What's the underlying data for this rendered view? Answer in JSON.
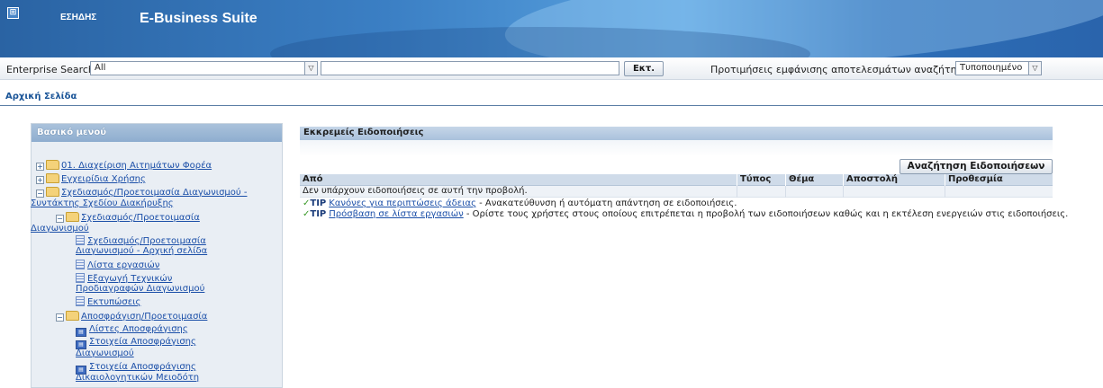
{
  "banner": {
    "brand": "ΕΣΗΔΗΣ",
    "app_title": "E-Business Suite",
    "logo_icon": "⊞"
  },
  "search": {
    "label": "Enterprise Search",
    "scope_value": "All",
    "query_value": "",
    "go_label": "Εκτ.",
    "pref_label": "Προτιμήσεις εμφάνισης αποτελεσμάτων αναζήτησης",
    "pref_value": "Τυποποιημένο"
  },
  "breadcrumb": "Αρχική Σελίδα",
  "menu": {
    "title": "Βασικό μενού",
    "items": [
      {
        "label": "01. Διαχείριση Αιτημάτων Φορέα"
      },
      {
        "label": "Εγχειρίδια Χρήσης"
      },
      {
        "label": "Σχεδιασμός/Προετοιμασία Διαγωνισμού -",
        "label2": "Συντάκτης Σχεδίου Διακήρυξης"
      },
      {
        "label": "Σχεδιασμός/Προετοιμασία",
        "label2": "Διαγωνισμού"
      },
      {
        "label": "Σχεδιασμός/Προετοιμασία",
        "label2": "Διαγωνισμού - Αρχική σελίδα"
      },
      {
        "label": "Λίστα εργασιών"
      },
      {
        "label": "Εξαγωγή Τεχνικών",
        "label2": "Προδιαγραφών Διαγωνισμού"
      },
      {
        "label": "Εκτυπώσεις"
      },
      {
        "label": "Αποσφράγιση/Προετοιμασία"
      },
      {
        "label": "Λίστες Αποσφράγισης"
      },
      {
        "label": "Στοιχεία Αποσφράγισης",
        "label2": "Διαγωνισμού"
      },
      {
        "label": "Στοιχεία Αποσφράγισης",
        "label2": "Δικαιολογητικών Μειοδότη"
      }
    ]
  },
  "notifications": {
    "title": "Εκκρεμείς Ειδοποιήσεις",
    "search_button": "Αναζήτηση Ειδοποιήσεων",
    "columns": [
      "Από",
      "Τύπος",
      "Θέμα",
      "Αποστολή",
      "Προθεσμία"
    ],
    "empty_message": "Δεν υπάρχουν ειδοποιήσεις σε αυτή την προβολή.",
    "tips": [
      {
        "label": "TIP",
        "link": "Κανόνες για περιπτώσεις άδειας",
        "text": " - Ανακατεύθυνση ή αυτόματη απάντηση σε ειδοποιήσεις."
      },
      {
        "label": "TIP",
        "link": "Πρόσβαση σε λίστα εργασιών",
        "text": " - Ορίστε τους χρήστες στους οποίους επιτρέπεται η προβολή των ειδοποιήσεων καθώς και η εκτέλεση ενεργειών στις ειδοποιήσεις."
      }
    ]
  }
}
